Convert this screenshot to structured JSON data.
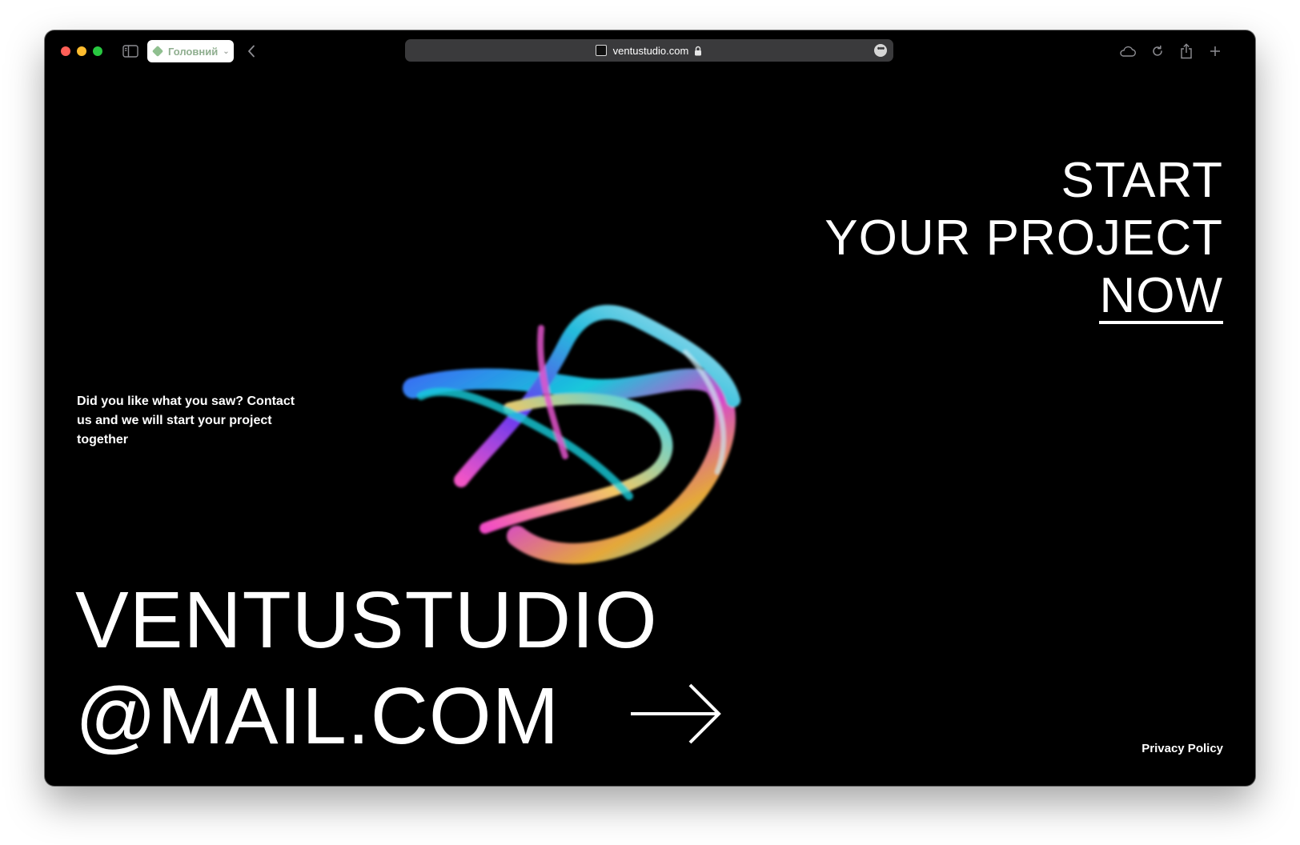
{
  "browser": {
    "tab_group_label": "Головний",
    "address": "ventustudio.com",
    "icons": {
      "sidebar": "sidebar-icon",
      "back": "chevron-left-icon",
      "lock": "lock-icon",
      "more": "ellipsis-icon",
      "cloud": "cloud-icon",
      "reload": "reload-icon",
      "share": "share-icon",
      "new_tab": "plus-icon"
    }
  },
  "page": {
    "cta": {
      "line1": "START",
      "line2": "YOUR PROJECT",
      "line3": "NOW"
    },
    "intro": "Did you like what you saw? Contact us and we will start your project together",
    "email": {
      "line1": "VENTUSTUDIO",
      "line2": "@MAIL.COM"
    },
    "privacy_policy": "Privacy Policy",
    "colors": {
      "background": "#000000",
      "text": "#ffffff"
    }
  }
}
